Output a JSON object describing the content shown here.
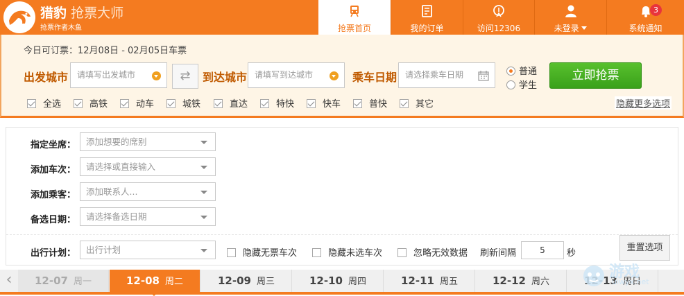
{
  "header": {
    "brand_bold": "猎豹",
    "brand_thin": "抢票大师",
    "sub": "抢票作者木鱼",
    "nav": [
      {
        "label": "抢票首页",
        "icon": "train-icon"
      },
      {
        "label": "我的订单",
        "icon": "order-list-icon"
      },
      {
        "label": "访问12306",
        "icon": "railway-logo-icon"
      },
      {
        "label": "未登录",
        "icon": "user-icon"
      },
      {
        "label": "系统通知",
        "icon": "bell-icon",
        "badge": "3"
      }
    ]
  },
  "search": {
    "today_text": "今日可订票：12月08日 - 02月05日车票",
    "from_label": "出发城市",
    "from_placeholder": "请填写出发城市",
    "to_label": "到达城市",
    "to_placeholder": "请填写到达城市",
    "date_label": "乘车日期",
    "date_placeholder": "请选择乘车日期",
    "radio_normal": "普通",
    "radio_student": "学生",
    "submit": "立即抢票",
    "filters": [
      "全选",
      "高铁",
      "动车",
      "城铁",
      "直达",
      "特快",
      "快车",
      "普快",
      "其它"
    ],
    "more_options": "隐藏更多选项"
  },
  "options": {
    "seat_label": "指定坐席：",
    "seat_placeholder": "添加想要的席别",
    "train_label": "添加车次：",
    "train_placeholder": "请选择或直接输入",
    "passenger_label": "添加乘客：",
    "passenger_placeholder": "添加联系人...",
    "backup_label": "备选日期：",
    "backup_placeholder": "请选择备选日期",
    "plan_label": "出行计划：",
    "plan_placeholder": "出行计划",
    "hide_no_ticket": "隐藏无票车次",
    "hide_unselected": "隐藏未选车次",
    "ignore_invalid": "忽略无效数据",
    "refresh_label": "刷新间隔",
    "refresh_value": "5",
    "refresh_unit": "秒",
    "reset": "重置选项"
  },
  "dates": [
    {
      "date": "12-07",
      "weekday": "周一"
    },
    {
      "date": "12-08",
      "weekday": "周二"
    },
    {
      "date": "12-09",
      "weekday": "周三"
    },
    {
      "date": "12-10",
      "weekday": "周四"
    },
    {
      "date": "12-11",
      "weekday": "周五"
    },
    {
      "date": "12-12",
      "weekday": "周六"
    },
    {
      "date": "12-13",
      "weekday": "周日"
    }
  ],
  "watermark": {
    "text1": "游戏",
    "text2": "uiwyx.net"
  },
  "colors": {
    "accent": "#f47b20",
    "green": "#3aa11a",
    "badge": "#e8343c"
  }
}
